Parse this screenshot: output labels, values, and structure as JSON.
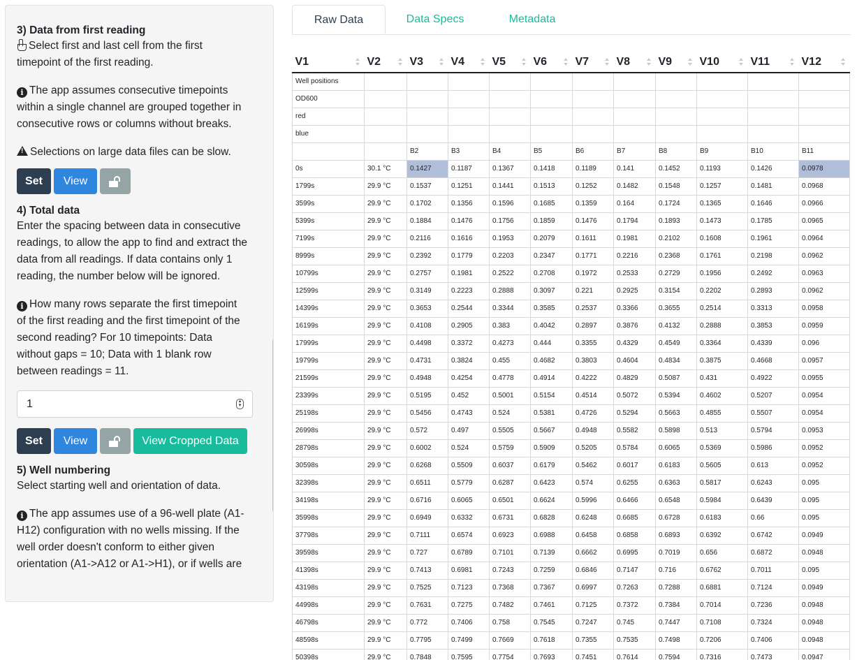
{
  "sidebar": {
    "s3": {
      "title": "3) Data from first reading",
      "desc1": "Select first and last cell from the first",
      "desc2": "timepoint of the first reading.",
      "info": [
        "The app assumes consecutive timepoints",
        "within a single channel are grouped together in",
        "consecutive rows or columns without breaks."
      ],
      "warn": "Selections on large data files can be slow.",
      "set": "Set",
      "view": "View"
    },
    "s4": {
      "title": "4) Total data",
      "desc": [
        "Enter the spacing between data in consecutive",
        "readings, to allow the app to find and extract the",
        "data from all readings. If data contains only 1",
        "reading, the number below will be ignored."
      ],
      "info": [
        "How many rows separate the first timepoint",
        "of the first reading and the first timepoint of the",
        "second reading? For 10 timepoints: Data",
        "without gaps = 10; Data with 1 blank row",
        "between readings = 11."
      ],
      "input_value": "1",
      "set": "Set",
      "view": "View",
      "cropped": "View Cropped Data"
    },
    "s5": {
      "title": "5) Well numbering",
      "desc": "Select starting well and orientation of data.",
      "info": [
        "The app assumes use of a 96-well plate (A1-",
        "H12) configuration with no wells missing. If the",
        "well order doesn't conform to either given",
        "orientation (A1->A12 or A1->H1), or if wells are"
      ]
    }
  },
  "tabs": [
    "Raw Data",
    "Data Specs",
    "Metadata"
  ],
  "table": {
    "headers": [
      "V1",
      "V2",
      "V3",
      "V4",
      "V5",
      "V6",
      "V7",
      "V8",
      "V9",
      "V10",
      "V11",
      "V12"
    ],
    "rows": [
      [
        "Well positions",
        "",
        "",
        "",
        "",
        "",
        "",
        "",
        "",
        "",
        "",
        ""
      ],
      [
        "OD600",
        "",
        "",
        "",
        "",
        "",
        "",
        "",
        "",
        "",
        "",
        ""
      ],
      [
        "red",
        "",
        "",
        "",
        "",
        "",
        "",
        "",
        "",
        "",
        "",
        ""
      ],
      [
        "blue",
        "",
        "",
        "",
        "",
        "",
        "",
        "",
        "",
        "",
        "",
        ""
      ],
      [
        "",
        "",
        "B2",
        "B3",
        "B4",
        "B5",
        "B6",
        "B7",
        "B8",
        "B9",
        "B10",
        "B11"
      ],
      [
        "0s",
        "30.1 °C",
        "0.1427",
        "0.1187",
        "0.1367",
        "0.1418",
        "0.1189",
        "0.141",
        "0.1452",
        "0.1193",
        "0.1426",
        "0.0978"
      ],
      [
        "1799s",
        "29.9 °C",
        "0.1537",
        "0.1251",
        "0.1441",
        "0.1513",
        "0.1252",
        "0.1482",
        "0.1548",
        "0.1257",
        "0.1481",
        "0.0968"
      ],
      [
        "3599s",
        "29.9 °C",
        "0.1702",
        "0.1356",
        "0.1596",
        "0.1685",
        "0.1359",
        "0.164",
        "0.1724",
        "0.1365",
        "0.1646",
        "0.0966"
      ],
      [
        "5399s",
        "29.9 °C",
        "0.1884",
        "0.1476",
        "0.1756",
        "0.1859",
        "0.1476",
        "0.1794",
        "0.1893",
        "0.1473",
        "0.1785",
        "0.0965"
      ],
      [
        "7199s",
        "29.9 °C",
        "0.2116",
        "0.1616",
        "0.1953",
        "0.2079",
        "0.1611",
        "0.1981",
        "0.2102",
        "0.1608",
        "0.1961",
        "0.0964"
      ],
      [
        "8999s",
        "29.9 °C",
        "0.2392",
        "0.1779",
        "0.2203",
        "0.2347",
        "0.1771",
        "0.2216",
        "0.2368",
        "0.1761",
        "0.2198",
        "0.0962"
      ],
      [
        "10799s",
        "29.9 °C",
        "0.2757",
        "0.1981",
        "0.2522",
        "0.2708",
        "0.1972",
        "0.2533",
        "0.2729",
        "0.1956",
        "0.2492",
        "0.0963"
      ],
      [
        "12599s",
        "29.9 °C",
        "0.3149",
        "0.2223",
        "0.2888",
        "0.3097",
        "0.221",
        "0.2925",
        "0.3154",
        "0.2202",
        "0.2893",
        "0.0962"
      ],
      [
        "14399s",
        "29.9 °C",
        "0.3653",
        "0.2544",
        "0.3344",
        "0.3585",
        "0.2537",
        "0.3366",
        "0.3655",
        "0.2514",
        "0.3313",
        "0.0958"
      ],
      [
        "16199s",
        "29.9 °C",
        "0.4108",
        "0.2905",
        "0.383",
        "0.4042",
        "0.2897",
        "0.3876",
        "0.4132",
        "0.2888",
        "0.3853",
        "0.0959"
      ],
      [
        "17999s",
        "29.9 °C",
        "0.4498",
        "0.3372",
        "0.4273",
        "0.444",
        "0.3355",
        "0.4329",
        "0.4549",
        "0.3364",
        "0.4339",
        "0.096"
      ],
      [
        "19799s",
        "29.9 °C",
        "0.4731",
        "0.3824",
        "0.455",
        "0.4682",
        "0.3803",
        "0.4604",
        "0.4834",
        "0.3875",
        "0.4668",
        "0.0957"
      ],
      [
        "21599s",
        "29.9 °C",
        "0.4948",
        "0.4254",
        "0.4778",
        "0.4914",
        "0.4222",
        "0.4829",
        "0.5087",
        "0.431",
        "0.4922",
        "0.0955"
      ],
      [
        "23399s",
        "29.9 °C",
        "0.5195",
        "0.452",
        "0.5001",
        "0.5154",
        "0.4514",
        "0.5072",
        "0.5394",
        "0.4602",
        "0.5207",
        "0.0954"
      ],
      [
        "25198s",
        "29.9 °C",
        "0.5456",
        "0.4743",
        "0.524",
        "0.5381",
        "0.4726",
        "0.5294",
        "0.5663",
        "0.4855",
        "0.5507",
        "0.0954"
      ],
      [
        "26998s",
        "29.9 °C",
        "0.572",
        "0.497",
        "0.5505",
        "0.5667",
        "0.4948",
        "0.5582",
        "0.5898",
        "0.513",
        "0.5794",
        "0.0953"
      ],
      [
        "28798s",
        "29.9 °C",
        "0.6002",
        "0.524",
        "0.5759",
        "0.5909",
        "0.5205",
        "0.5784",
        "0.6065",
        "0.5369",
        "0.5986",
        "0.0952"
      ],
      [
        "30598s",
        "29.9 °C",
        "0.6268",
        "0.5509",
        "0.6037",
        "0.6179",
        "0.5462",
        "0.6017",
        "0.6183",
        "0.5605",
        "0.613",
        "0.0952"
      ],
      [
        "32398s",
        "29.9 °C",
        "0.6511",
        "0.5779",
        "0.6287",
        "0.6423",
        "0.574",
        "0.6255",
        "0.6363",
        "0.5817",
        "0.6243",
        "0.095"
      ],
      [
        "34198s",
        "29.9 °C",
        "0.6716",
        "0.6065",
        "0.6501",
        "0.6624",
        "0.5996",
        "0.6466",
        "0.6548",
        "0.5984",
        "0.6439",
        "0.095"
      ],
      [
        "35998s",
        "29.9 °C",
        "0.6949",
        "0.6332",
        "0.6731",
        "0.6828",
        "0.6248",
        "0.6685",
        "0.6728",
        "0.6183",
        "0.66",
        "0.095"
      ],
      [
        "37798s",
        "29.9 °C",
        "0.7111",
        "0.6574",
        "0.6923",
        "0.6988",
        "0.6458",
        "0.6858",
        "0.6893",
        "0.6392",
        "0.6742",
        "0.0949"
      ],
      [
        "39598s",
        "29.9 °C",
        "0.727",
        "0.6789",
        "0.7101",
        "0.7139",
        "0.6662",
        "0.6995",
        "0.7019",
        "0.656",
        "0.6872",
        "0.0948"
      ],
      [
        "41398s",
        "29.9 °C",
        "0.7413",
        "0.6981",
        "0.7243",
        "0.7259",
        "0.6846",
        "0.7147",
        "0.716",
        "0.6762",
        "0.7011",
        "0.095"
      ],
      [
        "43198s",
        "29.9 °C",
        "0.7525",
        "0.7123",
        "0.7368",
        "0.7367",
        "0.6997",
        "0.7263",
        "0.7288",
        "0.6881",
        "0.7124",
        "0.0949"
      ],
      [
        "44998s",
        "29.9 °C",
        "0.7631",
        "0.7275",
        "0.7482",
        "0.7461",
        "0.7125",
        "0.7372",
        "0.7384",
        "0.7014",
        "0.7236",
        "0.0948"
      ],
      [
        "46798s",
        "29.9 °C",
        "0.772",
        "0.7406",
        "0.758",
        "0.7545",
        "0.7247",
        "0.745",
        "0.7447",
        "0.7108",
        "0.7324",
        "0.0948"
      ],
      [
        "48598s",
        "29.9 °C",
        "0.7795",
        "0.7499",
        "0.7669",
        "0.7618",
        "0.7355",
        "0.7535",
        "0.7498",
        "0.7206",
        "0.7406",
        "0.0948"
      ],
      [
        "50398s",
        "29.9 °C",
        "0.7848",
        "0.7595",
        "0.7754",
        "0.7693",
        "0.7451",
        "0.7614",
        "0.7594",
        "0.7316",
        "0.7473",
        "0.0947"
      ]
    ]
  }
}
